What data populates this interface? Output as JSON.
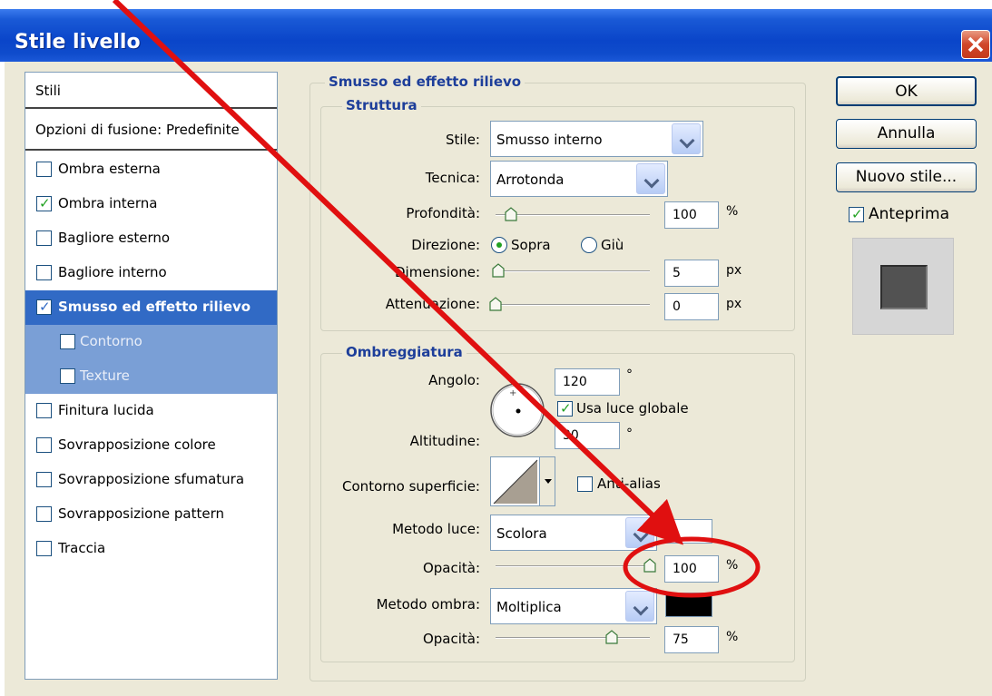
{
  "window": {
    "title": "Stile livello"
  },
  "styles_list": {
    "header": "Stili",
    "blending": "Opzioni di fusione: Predefinite",
    "items": [
      {
        "label": "Ombra esterna",
        "checked": false
      },
      {
        "label": "Ombra interna",
        "checked": true
      },
      {
        "label": "Bagliore esterno",
        "checked": false
      },
      {
        "label": "Bagliore interno",
        "checked": false
      },
      {
        "label": "Smusso ed effetto rilievo",
        "checked": true,
        "selected": true
      },
      {
        "label": "Contorno",
        "checked": false,
        "sub": true
      },
      {
        "label": "Texture",
        "checked": false,
        "sub": true
      },
      {
        "label": "Finitura lucida",
        "checked": false
      },
      {
        "label": "Sovrapposizione colore",
        "checked": false
      },
      {
        "label": "Sovrapposizione sfumatura",
        "checked": false
      },
      {
        "label": "Sovrapposizione pattern",
        "checked": false
      },
      {
        "label": "Traccia",
        "checked": false
      }
    ]
  },
  "panel": {
    "title": "Smusso ed effetto rilievo",
    "structure": {
      "title": "Struttura",
      "style_label": "Stile:",
      "style_value": "Smusso interno",
      "technique_label": "Tecnica:",
      "technique_value": "Arrotonda",
      "depth_label": "Profondità:",
      "depth_value": "100",
      "depth_unit": "%",
      "depth_slider": 0.1,
      "direction_label": "Direzione:",
      "direction_up": "Sopra",
      "direction_down": "Giù",
      "size_label": "Dimensione:",
      "size_value": "5",
      "size_unit": "px",
      "size_slider": 0.02,
      "soften_label": "Attenuazione:",
      "soften_value": "0",
      "soften_unit": "px",
      "soften_slider": 0.0
    },
    "shading": {
      "title": "Ombreggiatura",
      "angle_label": "Angolo:",
      "angle_value": "120",
      "angle_unit": "°",
      "global_light_label": "Usa luce globale",
      "altitude_label": "Altitudine:",
      "altitude_value": "30",
      "altitude_unit": "°",
      "gloss_label": "Contorno superficie:",
      "antialias_label": "Anti-alias",
      "highlight_mode_label": "Metodo luce:",
      "highlight_mode_value": "Scolora",
      "highlight_color": "#ffffff",
      "highlight_opacity_label": "Opacità:",
      "highlight_opacity_value": "100",
      "highlight_opacity_unit": "%",
      "highlight_opacity_slider": 1.0,
      "shadow_mode_label": "Metodo ombra:",
      "shadow_mode_value": "Moltiplica",
      "shadow_color": "#000000",
      "shadow_opacity_label": "Opacità:",
      "shadow_opacity_value": "75",
      "shadow_opacity_unit": "%",
      "shadow_opacity_slider": 0.75
    }
  },
  "buttons": {
    "ok": "OK",
    "cancel": "Annulla",
    "new_style": "Nuovo stile...",
    "preview": "Anteprima"
  },
  "annotation": {
    "arrow_color": "#e01010",
    "circle_color": "#e01010"
  }
}
